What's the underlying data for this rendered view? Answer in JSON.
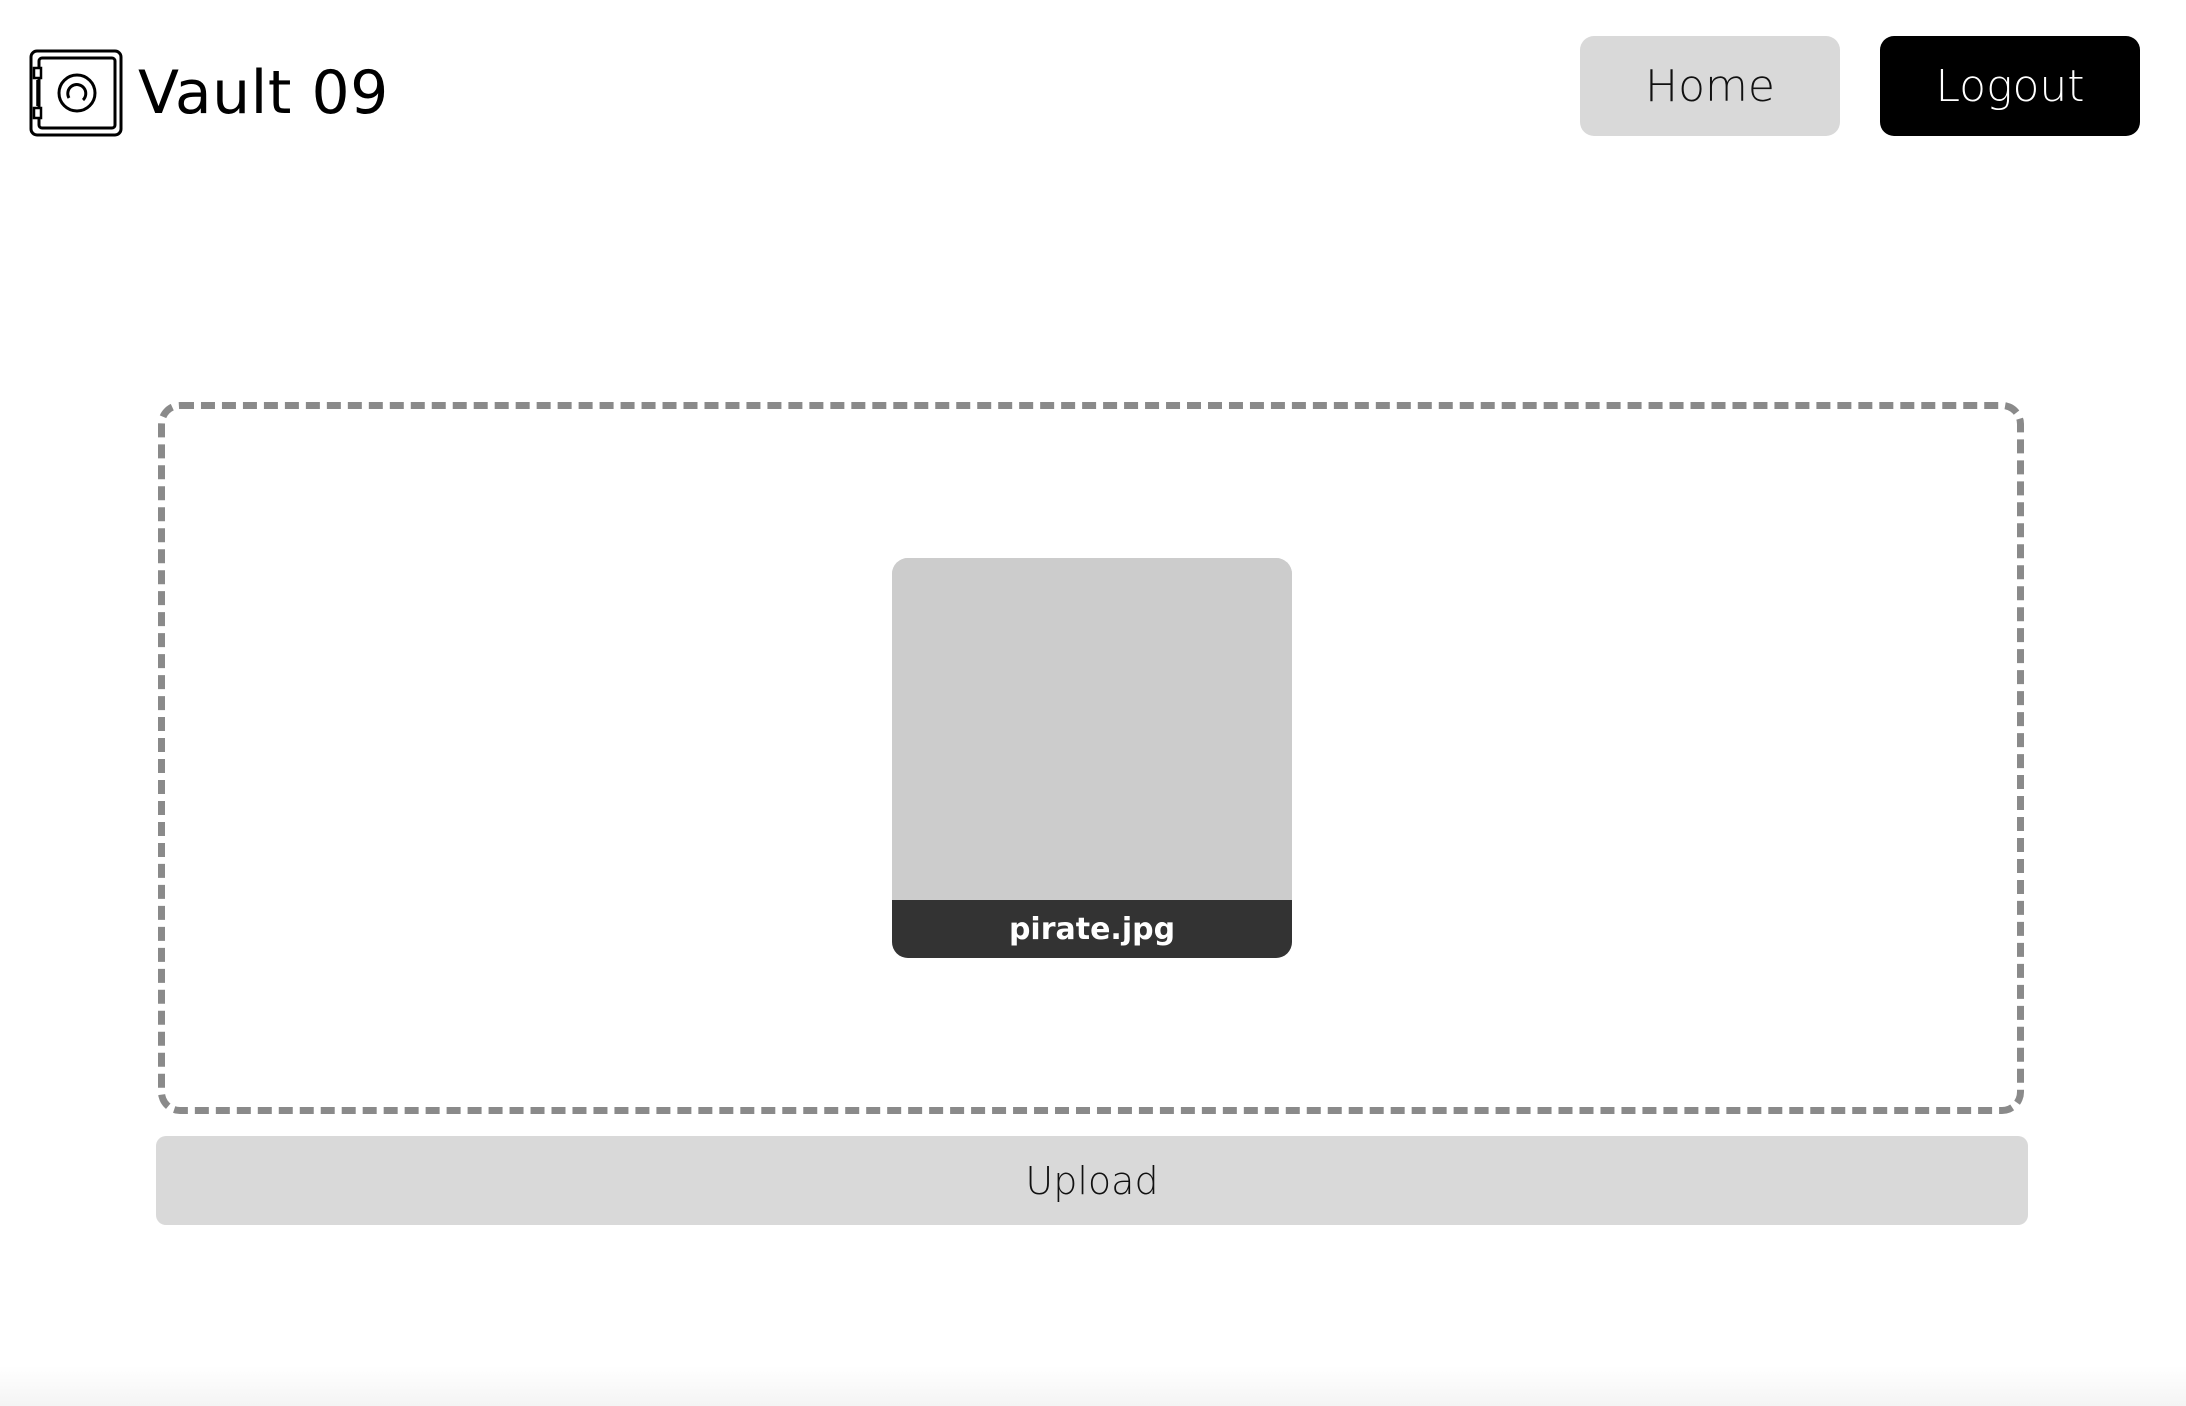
{
  "header": {
    "app_name": "Vault 09",
    "logo_icon": "safe-icon",
    "nav": {
      "home_label": "Home",
      "logout_label": "Logout"
    }
  },
  "dropzone": {
    "files": [
      {
        "name": "pirate.jpg"
      }
    ]
  },
  "actions": {
    "upload_label": "Upload"
  },
  "colors": {
    "button_light": "#d9d9d9",
    "button_dark": "#000000",
    "dropzone_border": "#8a8a8a",
    "thumbnail": "#cccccc",
    "file_label_bg": "#333333"
  }
}
